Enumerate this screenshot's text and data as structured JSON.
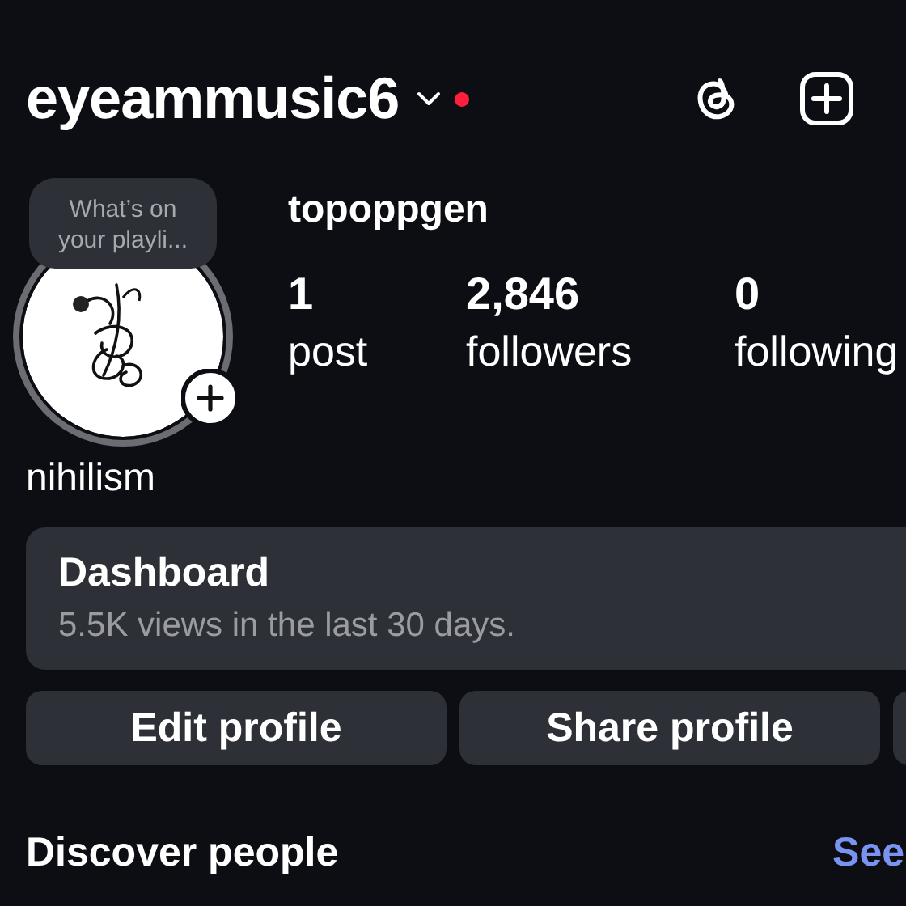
{
  "header": {
    "username": "eyeammusic6",
    "has_dropdown": true,
    "notification_dot": true
  },
  "profile": {
    "note": "What’s on\nyour playli...",
    "display_name": "topoppgen",
    "bio": "nihilism",
    "stats": [
      {
        "value": "1",
        "label": "post"
      },
      {
        "value": "2,846",
        "label": "followers"
      },
      {
        "value": "0",
        "label": "following"
      }
    ]
  },
  "dashboard": {
    "title": "Dashboard",
    "subtitle": "5.5K views in the last 30 days."
  },
  "buttons": [
    "Edit profile",
    "Share profile"
  ],
  "discover": {
    "title": "Discover people",
    "link": "See"
  }
}
